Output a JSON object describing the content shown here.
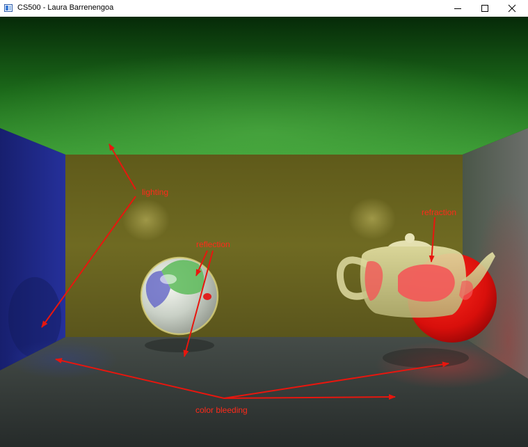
{
  "window": {
    "title": "CS500 - Laura Barrenengoa",
    "icon": "app-window-icon",
    "controls": [
      "minimize-icon",
      "maximize-icon",
      "close-icon"
    ]
  },
  "scene": {
    "description_colors": {
      "ceiling": "#2f8f2a",
      "back_wall": "#6e6920",
      "left_wall": "#1e2a8c",
      "right_wall": "#4c5a52",
      "floor": "#3a423e",
      "red_sphere": "#e01414",
      "annotation": "#ff2a1a"
    },
    "annotations": {
      "lighting": "lighting",
      "reflection": "reflection",
      "refraction": "refraction",
      "color_bleeding": "color bleeding"
    }
  }
}
